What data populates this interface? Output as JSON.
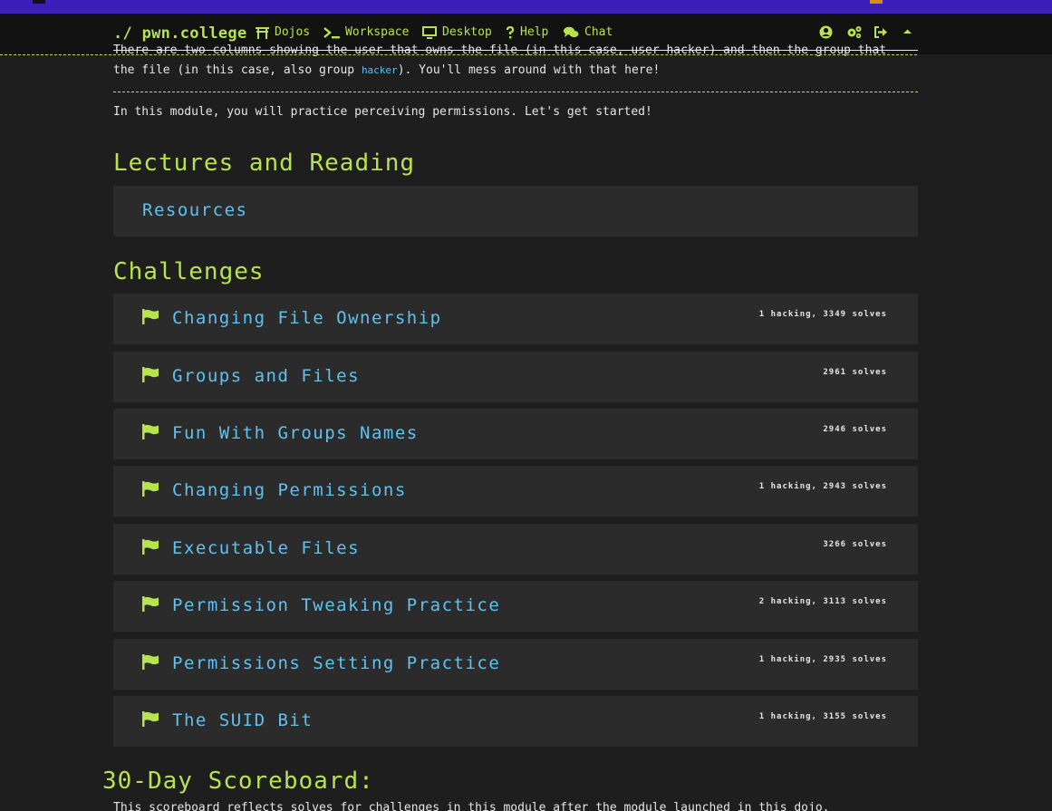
{
  "navbar": {
    "brand": "./ pwn.college",
    "items": [
      {
        "label": "Dojos",
        "icon": "torii-gate-icon"
      },
      {
        "label": "Workspace",
        "icon": "terminal-icon"
      },
      {
        "label": "Desktop",
        "icon": "desktop-icon"
      },
      {
        "label": "Help",
        "icon": "question-icon"
      },
      {
        "label": "Chat",
        "icon": "chat-icon"
      }
    ],
    "right_icons": [
      "user-circle-icon",
      "cogs-icon",
      "sign-out-icon",
      "caret-up-icon"
    ]
  },
  "description": {
    "cut_line": "There are two columns showing the user that owns the file (in this case, user hacker) and then the group that owns",
    "line_before": "the file (in this case, also group ",
    "code": "hacker",
    "line_after": "). You'll mess around with that here!",
    "intro": "In this module, you will practice perceiving permissions. Let's get started!"
  },
  "lectures": {
    "heading": "Lectures and Reading",
    "resources_label": "Resources"
  },
  "challenges": {
    "heading": "Challenges",
    "items": [
      {
        "title": "Changing File Ownership",
        "stats": "1 hacking, 3349 solves"
      },
      {
        "title": "Groups and Files",
        "stats": "2961 solves"
      },
      {
        "title": "Fun With Groups Names",
        "stats": "2946 solves"
      },
      {
        "title": "Changing Permissions",
        "stats": "1 hacking, 2943 solves"
      },
      {
        "title": "Executable Files",
        "stats": "3266 solves"
      },
      {
        "title": "Permission Tweaking Practice",
        "stats": "2 hacking, 3113 solves"
      },
      {
        "title": "Permissions Setting Practice",
        "stats": "1 hacking, 2935 solves"
      },
      {
        "title": "The SUID Bit",
        "stats": "1 hacking, 3155 solves"
      }
    ]
  },
  "scoreboard": {
    "heading": "30-Day Scoreboard:",
    "note": "This scoreboard reflects solves for challenges in this module after the module launched in this dojo."
  },
  "colors": {
    "accent": "#b7e34e",
    "link": "#5fc2f0",
    "background": "#1e1e1e",
    "card": "#2b2b2b",
    "topstrip": "#3a1fb8"
  }
}
